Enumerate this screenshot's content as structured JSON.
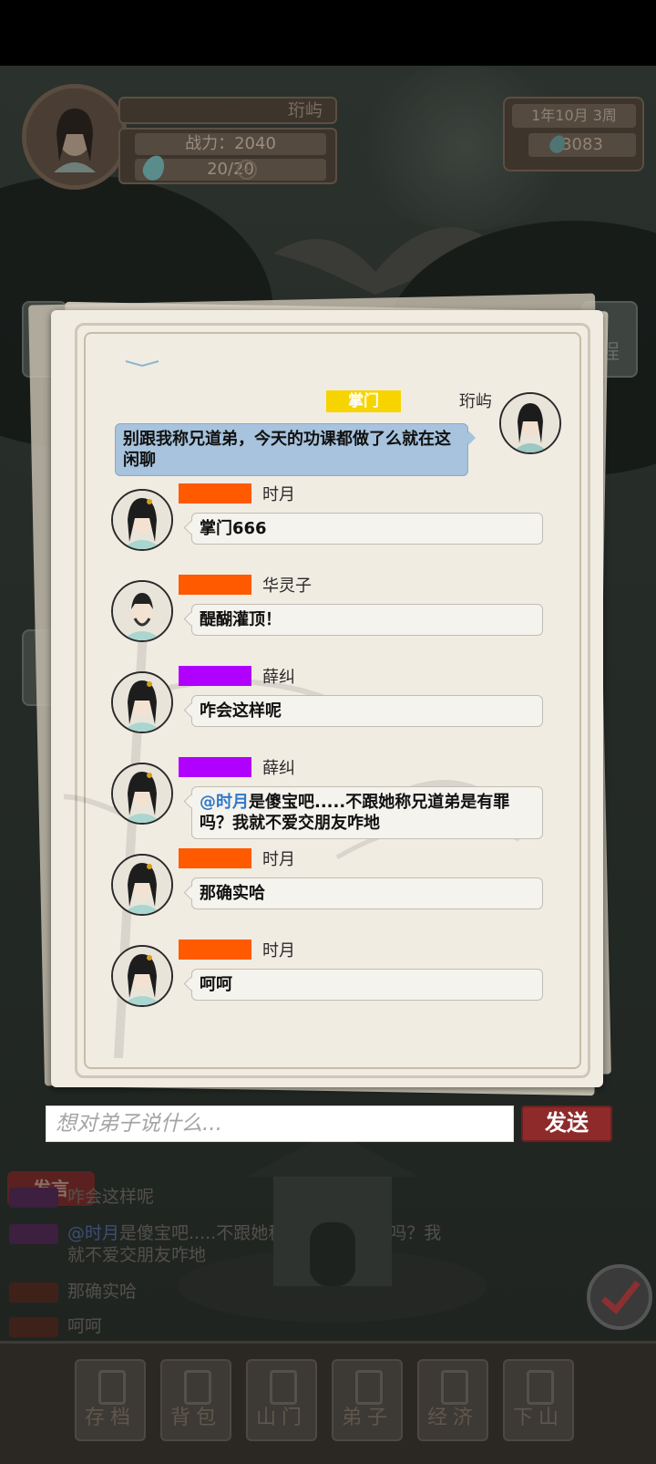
{
  "hud": {
    "player_name": "珩屿",
    "power": "战力：2040",
    "stamina": "20/20",
    "date": "1年10月 3周",
    "money": "3083",
    "side_label": "程"
  },
  "background": {
    "speak_label": "发言",
    "log": [
      {
        "text": "咋会这样呢"
      },
      {
        "at": "@时月",
        "text": "是傻宝吧.....不跟她称兄道弟是有罪吗？我"
      },
      {
        "text": "就不爱交朋友咋地"
      },
      {
        "text": "那确实哈"
      },
      {
        "text": "呵呵"
      }
    ],
    "nav": [
      "存档",
      "背包",
      "山门",
      "弟子",
      "经济",
      "下山"
    ]
  },
  "dialog": {
    "self_message": {
      "badge": "掌门",
      "name": "珩屿",
      "text": "别跟我称兄道弟，今天的功课都做了么就在这闲聊"
    },
    "messages": [
      {
        "name": "时月",
        "tag_color": "#ff5a00",
        "text": "掌门666"
      },
      {
        "name": "华灵子",
        "tag_color": "#ff5a00",
        "text": "醍醐灌顶！"
      },
      {
        "name": "薛纠",
        "tag_color": "#b000ff",
        "text": "咋会这样呢"
      },
      {
        "name": "薛纠",
        "tag_color": "#b000ff",
        "at": "@时月",
        "text": "是傻宝吧.....不跟她称兄道弟是有罪吗？我就不爱交朋友咋地"
      },
      {
        "name": "时月",
        "tag_color": "#ff5a00",
        "text": "那确实哈"
      },
      {
        "name": "时月",
        "tag_color": "#ff5a00",
        "text": "呵呵"
      }
    ]
  },
  "input": {
    "placeholder": "想对弟子说什么...",
    "send_label": "发送"
  }
}
